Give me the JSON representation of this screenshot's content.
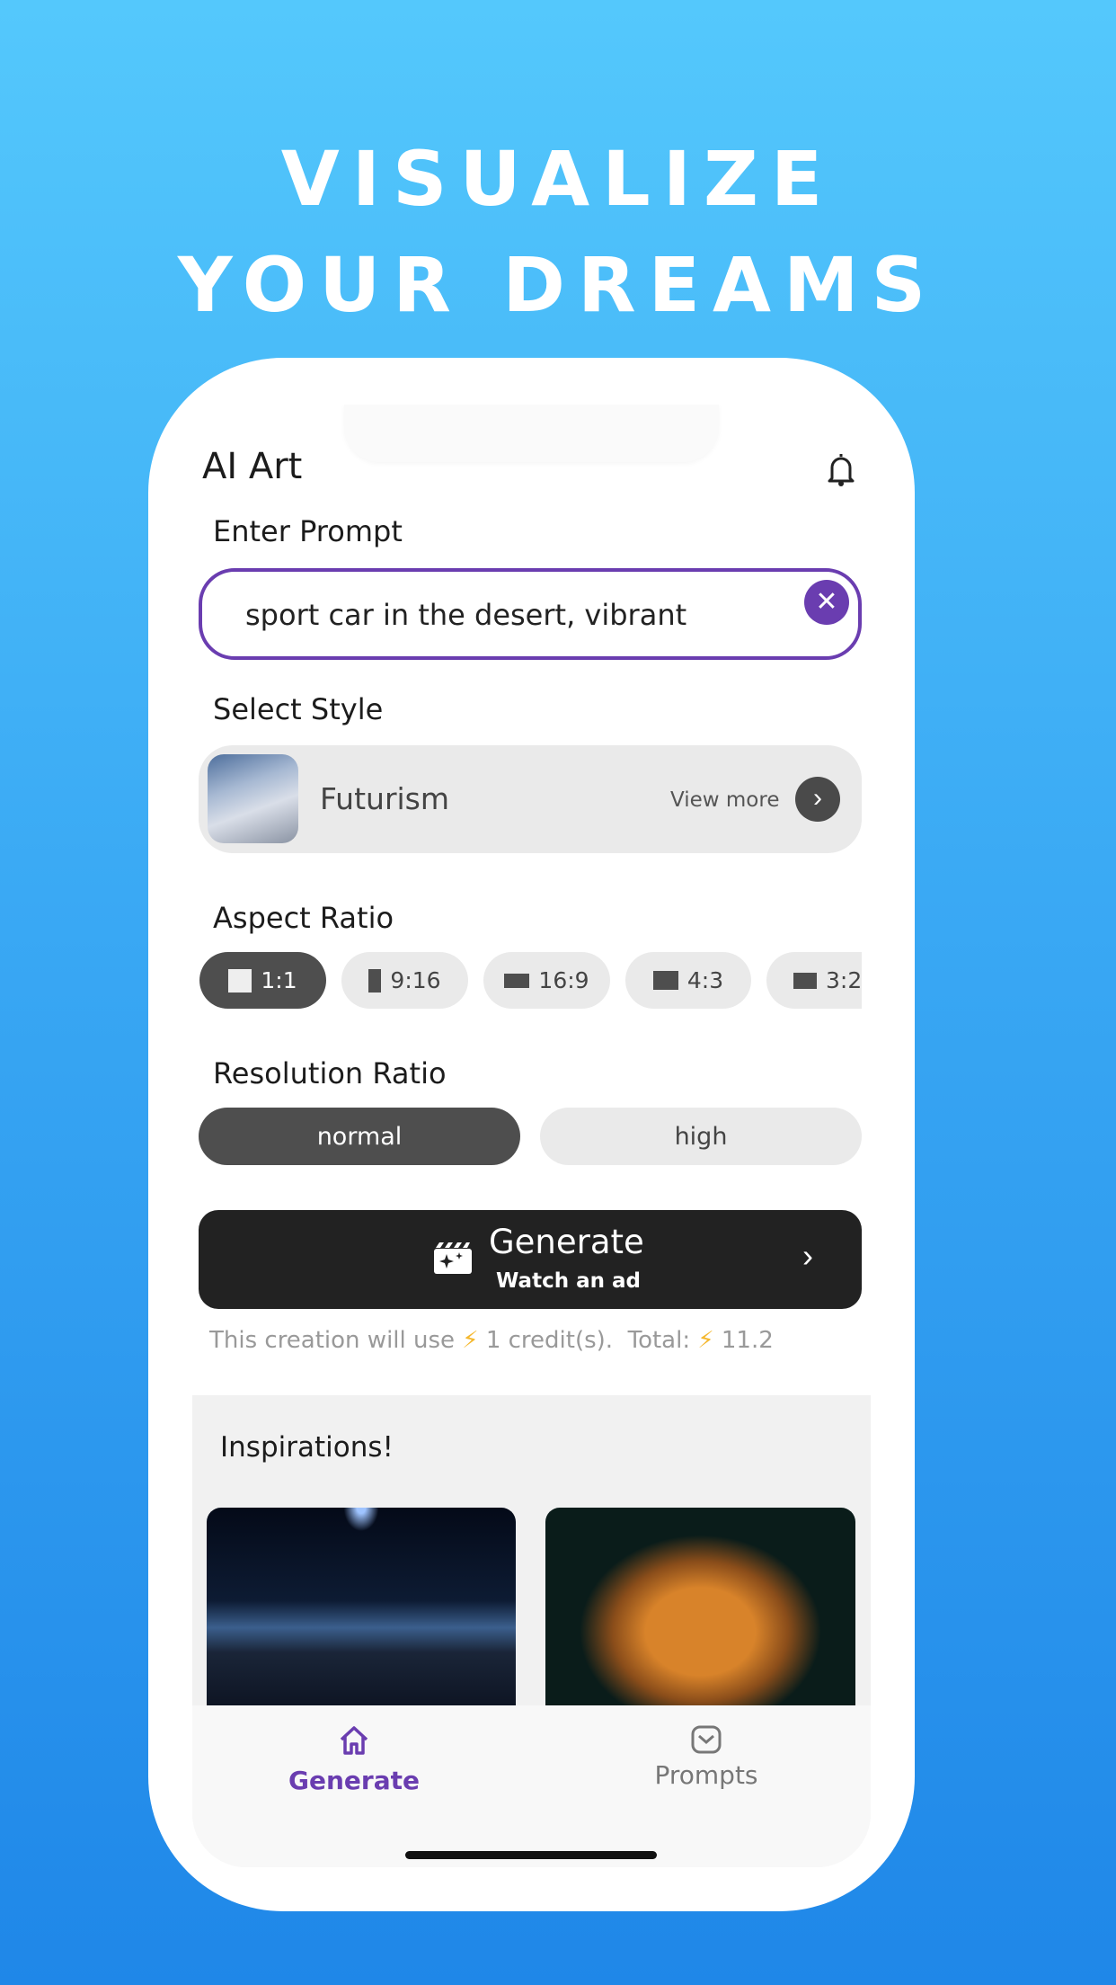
{
  "hero": {
    "line1": "VISUALIZE",
    "line2": "YOUR DREAMS"
  },
  "header": {
    "title": "AI Art",
    "icon": "bell-icon"
  },
  "prompt": {
    "label": "Enter Prompt",
    "value": "sport car in the desert, vibrant",
    "clear_icon": "close-icon"
  },
  "style": {
    "label": "Select Style",
    "name": "Futurism",
    "view_more": "View more"
  },
  "aspect": {
    "label": "Aspect Ratio",
    "selected": "1:1",
    "options": [
      "1:1",
      "9:16",
      "16:9",
      "4:3",
      "3:2"
    ]
  },
  "resolution": {
    "label": "Resolution Ratio",
    "selected": "normal",
    "options": [
      "normal",
      "high"
    ]
  },
  "generate": {
    "title": "Generate",
    "subtitle": "Watch an ad"
  },
  "credits": {
    "prefix": "This creation will use",
    "cost": "1 credit(s).",
    "total_label": "Total:",
    "total": "11.2"
  },
  "inspirations": {
    "title": "Inspirations!"
  },
  "nav": {
    "items": [
      {
        "label": "Generate",
        "icon": "home-icon",
        "active": true
      },
      {
        "label": "Prompts",
        "icon": "message-icon",
        "active": false
      }
    ]
  },
  "colors": {
    "accent": "#6a3db0",
    "dark": "#222222",
    "bolt": "#f5b82e"
  }
}
